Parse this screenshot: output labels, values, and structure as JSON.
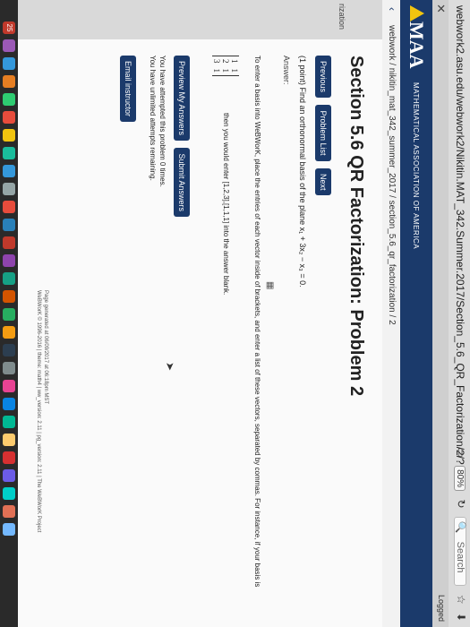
{
  "browser": {
    "url": "webwork2.asu.edu/webwork2/Nikitin.MAT_342.Summer.2017/Section_5.6_QR_Factorization/2/?",
    "zoom": "80%",
    "search_placeholder": "Search"
  },
  "toolbar": {
    "close_glyph": "✕",
    "login_label": "Logged"
  },
  "header": {
    "logo": "MAA",
    "org_name": "MATHEMATICAL ASSOCIATION OF AMERICA"
  },
  "breadcrumb": "webwork / nikitin_mat_342_summer_2017 / section_5.6_qr_factorization / 2",
  "leftnav": {
    "label": "rization"
  },
  "main": {
    "title": "Section 5.6 QR Factorization: Problem 2",
    "buttons": [
      "Previous",
      "Problem List",
      "Next"
    ],
    "problem": "(1 point) Find an orthonormal basis of the plane x₁ + 3x₂ − x₃ = 0.",
    "answer_label": "Answer:",
    "instructions": "To enter a basis into WeBWorK, place the entries of each vector inside of brackets, and enter a list of these vectors, separated by commas. For instance, if your basis is",
    "matrix_rows": [
      [
        "1",
        "1"
      ],
      [
        "2",
        "1"
      ],
      [
        "3",
        "1"
      ]
    ],
    "matrix_note": "then you would enter [1,2,3],[1,1,1] into the answer blank.",
    "action_buttons": [
      "Preview My Answers",
      "Submit Answers"
    ],
    "attempts_line1": "You have attempted this problem 0 times.",
    "attempts_line2": "You have unlimited attempts remaining.",
    "email_button": "Email instructor",
    "footer_line1": "Page generated at 06/09/2017 at 06:18pm MST",
    "footer_line2": "WeBWorK © 1996-2016 | theme: math4 | ww_version: 2.11 | pg_version: 2.11 | The WeBWorK Project"
  },
  "dock": {
    "notification_badge": "25",
    "icon_colors": [
      "#9b59b6",
      "#3498db",
      "#e67e22",
      "#2ecc71",
      "#e74c3c",
      "#f1c40f",
      "#1abc9c",
      "#3498db",
      "#95a5a6",
      "#e74c3c",
      "#2980b9",
      "#c0392b",
      "#8e44ad",
      "#16a085",
      "#d35400",
      "#27ae60",
      "#f39c12",
      "#2c3e50",
      "#7f8c8d",
      "#e84393",
      "#0984e3",
      "#00b894",
      "#fdcb6e",
      "#d63031",
      "#6c5ce7",
      "#00cec9",
      "#e17055",
      "#74b9ff"
    ]
  }
}
